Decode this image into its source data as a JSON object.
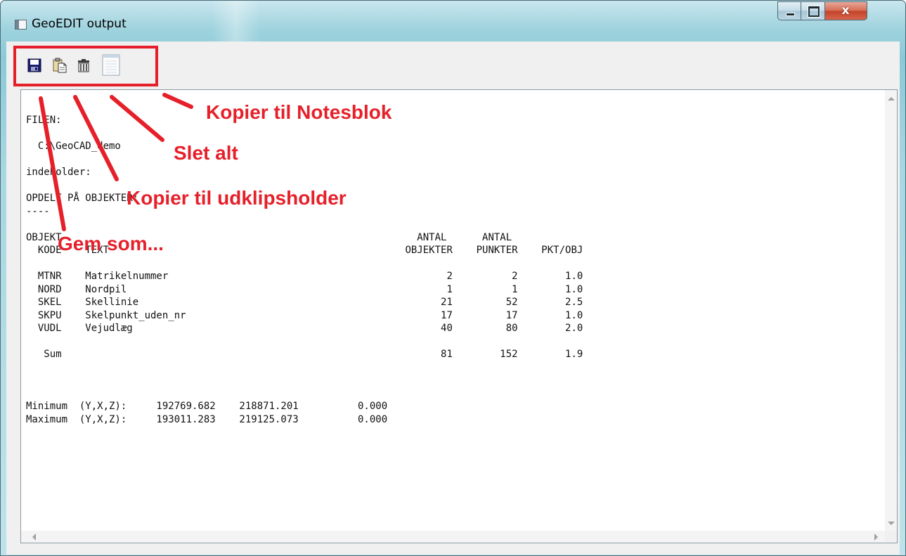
{
  "window": {
    "title": "GeoEDIT output",
    "close_glyph": "x"
  },
  "toolbar": {
    "buttons": [
      {
        "icon": "save-icon",
        "annotation": "Gem som..."
      },
      {
        "icon": "clipboard-icon",
        "annotation": "Kopier til udklipsholder"
      },
      {
        "icon": "trash-icon",
        "annotation": "Slet alt"
      },
      {
        "icon": "notepad-icon",
        "annotation": "Kopier til Notesblok"
      }
    ]
  },
  "output": {
    "text": "FILEN:\n\n  C:\\GeoCAD_demo\n\nindeholder:\n\nOPDELT PÅ OBJEKTER:\n----\n\nOBJEKT                                                            ANTAL      ANTAL\n  KODE    TEXT                                                  OBJEKTER    PUNKTER    PKT/OBJ\n\n  MTNR    Matrikelnummer                                               2          2        1.0\n  NORD    Nordpil                                                      1          1        1.0\n  SKEL    Skellinie                                                   21         52        2.5\n  SKPU    Skelpunkt_uden_nr                                           17         17        1.0\n  VUDL    Vejudlæg                                                    40         80        2.0\n\n   Sum                                                                81        152        1.9\n\n\n\nMinimum  (Y,X,Z):     192769.682    218871.201          0.000\nMaximum  (Y,X,Z):     193011.283    219125.073          0.000"
  },
  "colors": {
    "annotation": "#e6202a",
    "title_bar": "#9fd3de",
    "close_button": "#c2432a"
  }
}
